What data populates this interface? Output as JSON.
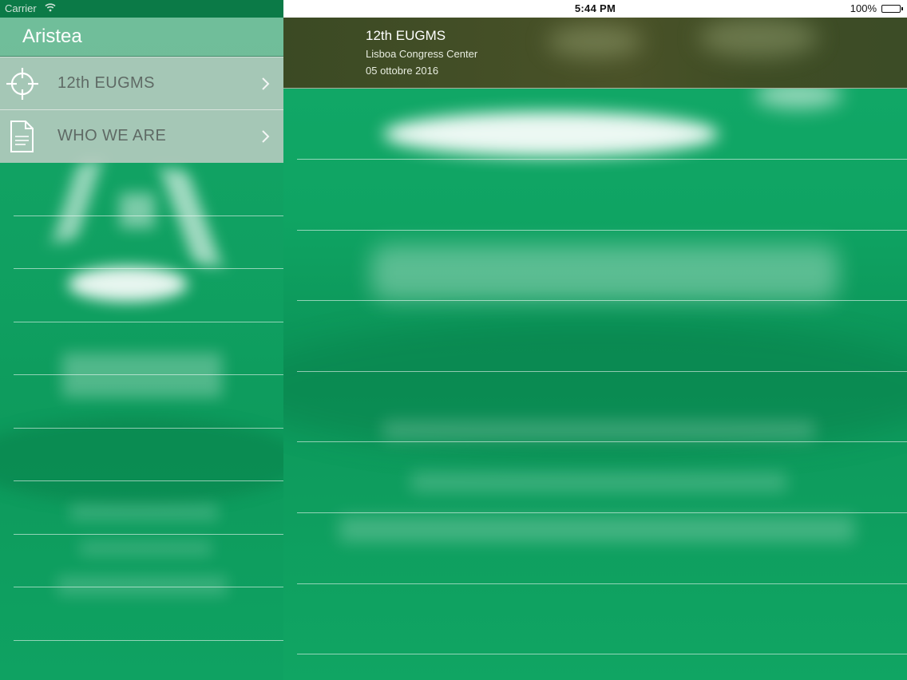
{
  "status_bar": {
    "carrier": "Carrier",
    "time": "5:44 PM",
    "battery": "100%",
    "battery_level": 1.0
  },
  "sidebar": {
    "title": "Aristea",
    "items": [
      {
        "label": "12th EUGMS",
        "icon": "crosshair-icon"
      },
      {
        "label": "WHO WE ARE",
        "icon": "document-icon"
      }
    ]
  },
  "event": {
    "title": "12th EUGMS",
    "venue": "Lisboa Congress Center",
    "date": "05 ottobre 2016"
  },
  "colors": {
    "brand_green": "#0d9a5c",
    "header_olive": "#44502a",
    "menu_gray": "#becdc4"
  }
}
